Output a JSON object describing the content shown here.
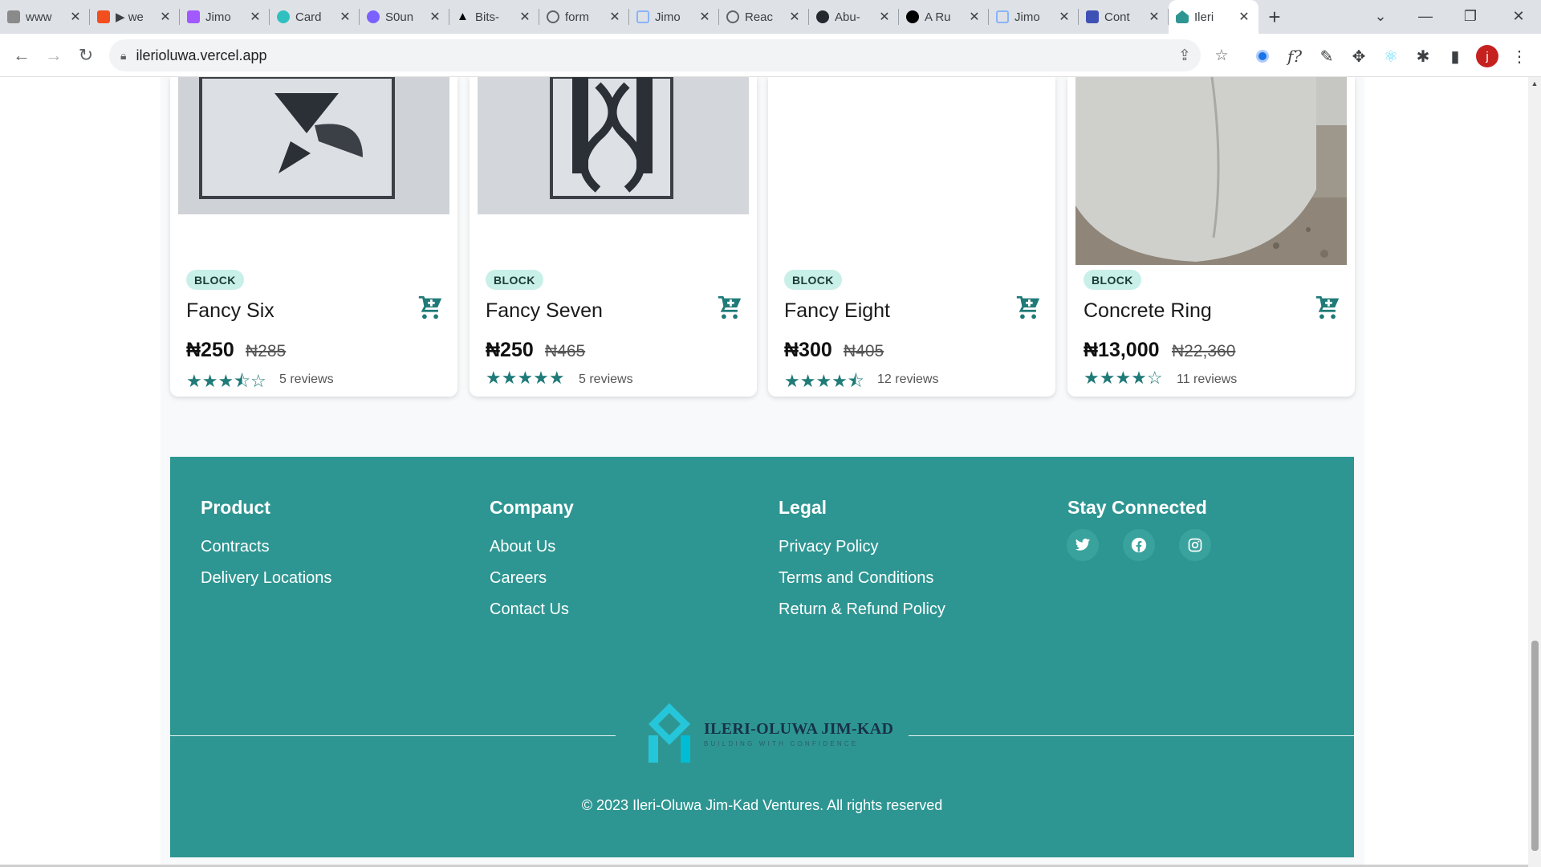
{
  "browser": {
    "tabs": [
      {
        "title": "www",
        "favicon_color": "#8a8a8a"
      },
      {
        "title": "▶ we",
        "favicon_color": "#f24e1e"
      },
      {
        "title": "Jimo",
        "favicon_color": "#a259ff"
      },
      {
        "title": "Card",
        "favicon_color": "#30c0c0"
      },
      {
        "title": "S0un",
        "favicon_color": "#7b61ff"
      },
      {
        "title": "Bits-",
        "favicon_color": "#000000"
      },
      {
        "title": "form",
        "favicon_color": "#5f6368"
      },
      {
        "title": "Jimo",
        "favicon_color": "#8ab4f8"
      },
      {
        "title": "Reac",
        "favicon_color": "#5f6368"
      },
      {
        "title": "Abu-",
        "favicon_color": "#24292f"
      },
      {
        "title": "A Ru",
        "favicon_color": "#000000"
      },
      {
        "title": "Jimo",
        "favicon_color": "#8ab4f8"
      },
      {
        "title": "Cont",
        "favicon_color": "#3f51b5"
      },
      {
        "title": "Ileri",
        "favicon_color": "#2e9692"
      }
    ],
    "active_tab_index": 13,
    "url": "ilerioluwa.vercel.app",
    "profile_initial": "j"
  },
  "products": [
    {
      "category": "BLOCK",
      "name": "Fancy Six",
      "price": "₦250",
      "old_price": "₦285",
      "rating": 3.5,
      "stars": "★★★⯪☆",
      "reviews": "5 reviews"
    },
    {
      "category": "BLOCK",
      "name": "Fancy Seven",
      "price": "₦250",
      "old_price": "₦465",
      "rating": 5,
      "stars": "★★★★★",
      "reviews": "5 reviews"
    },
    {
      "category": "BLOCK",
      "name": "Fancy Eight",
      "price": "₦300",
      "old_price": "₦405",
      "rating": 4.5,
      "stars": "★★★★⯪",
      "reviews": "12 reviews"
    },
    {
      "category": "BLOCK",
      "name": "Concrete Ring",
      "price": "₦13,000",
      "old_price": "₦22,360",
      "rating": 4,
      "stars": "★★★★☆",
      "reviews": "11 reviews"
    }
  ],
  "footer": {
    "product": {
      "heading": "Product",
      "links": [
        "Contracts",
        "Delivery Locations"
      ]
    },
    "company": {
      "heading": "Company",
      "links": [
        "About Us",
        "Careers",
        "Contact Us"
      ]
    },
    "legal": {
      "heading": "Legal",
      "links": [
        "Privacy Policy",
        "Terms and Conditions",
        "Return & Refund Policy"
      ]
    },
    "social": {
      "heading": "Stay Connected",
      "icons": [
        "twitter-icon",
        "facebook-icon",
        "instagram-icon"
      ]
    },
    "logo_title": "ILERI-OLUWA JIM-KAD",
    "logo_subtitle": "BUILDING WITH CONFIDENCE",
    "copyright": "© 2023 Ileri-Oluwa Jim-Kad Ventures. All rights reserved"
  },
  "colors": {
    "brand_teal": "#2e9692",
    "accent_dark_teal": "#1f7a78",
    "badge_bg": "#c8f0e8"
  }
}
